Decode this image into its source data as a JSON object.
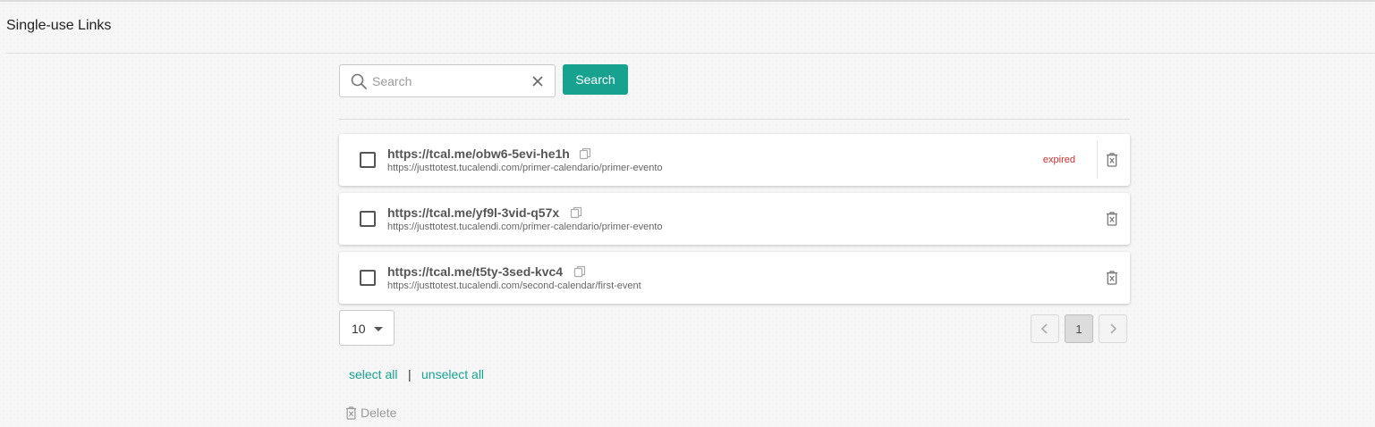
{
  "page": {
    "title": "Single-use Links"
  },
  "search": {
    "placeholder": "Search",
    "value": "",
    "button_label": "Search"
  },
  "links": [
    {
      "short_url": "https://tcal.me/obw6-5evi-he1h",
      "target_url": "https://justtotest.tucalendi.com/primer-calendario/primer-evento",
      "status": "expired",
      "checked": false
    },
    {
      "short_url": "https://tcal.me/yf9l-3vid-q57x",
      "target_url": "https://justtotest.tucalendi.com/primer-calendario/primer-evento",
      "status": "",
      "checked": false
    },
    {
      "short_url": "https://tcal.me/t5ty-3sed-kvc4",
      "target_url": "https://justtotest.tucalendi.com/second-calendar/first-event",
      "status": "",
      "checked": false
    }
  ],
  "pagination": {
    "page_size": "10",
    "current_page": "1"
  },
  "selection": {
    "select_all_label": "select all",
    "separator": "|",
    "unselect_all_label": "unselect all"
  },
  "actions": {
    "delete_label": "Delete"
  },
  "colors": {
    "accent": "#17a290",
    "expired": "#d32f2f",
    "background": "#f6f6f6"
  }
}
